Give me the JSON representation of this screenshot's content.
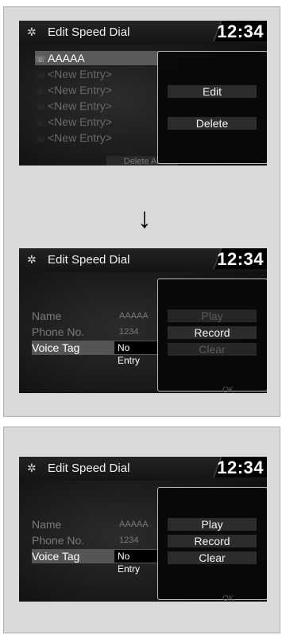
{
  "screens": [
    {
      "title": "Edit Speed Dial",
      "clock": "12:34",
      "entries": [
        "AAAAA",
        "<New Entry>",
        "<New Entry>",
        "<New Entry>",
        "<New Entry>",
        "<New Entry>"
      ],
      "footer_button": "Delete All",
      "popup_buttons": [
        "Edit",
        "Delete"
      ]
    },
    {
      "title": "Edit Speed Dial",
      "clock": "12:34",
      "fields": [
        {
          "label": "Name",
          "value": "AAAAA"
        },
        {
          "label": "Phone No.",
          "value": "1234"
        },
        {
          "label": "Voice Tag",
          "value": "No Entry"
        }
      ],
      "popup_buttons": [
        "Play",
        "Record",
        "Clear"
      ],
      "popup_hint": "OK"
    },
    {
      "title": "Edit Speed Dial",
      "clock": "12:34",
      "fields": [
        {
          "label": "Name",
          "value": "AAAAA"
        },
        {
          "label": "Phone No.",
          "value": "1234"
        },
        {
          "label": "Voice Tag",
          "value": "No Entry"
        }
      ],
      "popup_buttons": [
        "Play",
        "Record",
        "Clear"
      ],
      "popup_hint": "OK"
    }
  ],
  "arrow": "↓",
  "colors": {
    "screen_bg": "#141414",
    "highlight": "#555555",
    "panel": "#d9d9d9"
  }
}
